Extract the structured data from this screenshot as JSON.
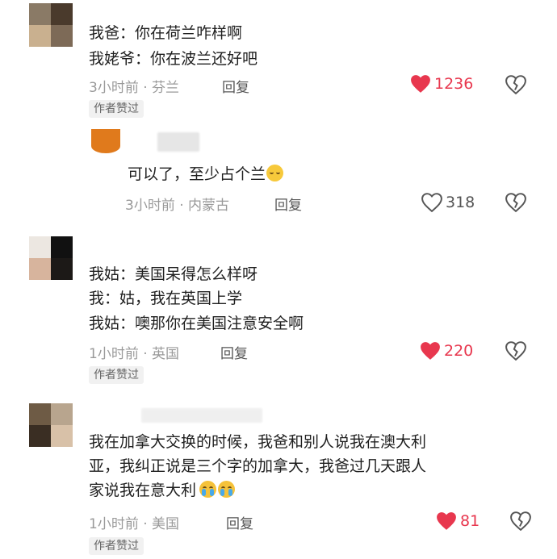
{
  "accent": "#e8374e",
  "comments": [
    {
      "lines": [
        "我爸：你在荷兰咋样啊",
        "我姥爷：你在波兰还好吧"
      ],
      "time_loc": "3小时前 · 芬兰",
      "reply": "回复",
      "likes": "1236",
      "liked": true,
      "badge": "作者赞过"
    },
    {
      "lines": [
        "可以了，至少占个兰"
      ],
      "time_loc": "3小时前 · 内蒙古",
      "reply": "回复",
      "likes": "318",
      "liked": false
    },
    {
      "lines": [
        "我姑：美国呆得怎么样呀",
        "我：姑，我在英国上学",
        "我姑：噢那你在美国注意安全啊"
      ],
      "time_loc": "1小时前 · 英国",
      "reply": "回复",
      "likes": "220",
      "liked": true,
      "badge": "作者赞过"
    },
    {
      "lines": [
        "我在加拿大交换的时候，我爸和别人说我在澳大利",
        "亚，我纠正说是三个字的加拿大，我爸过几天跟人",
        "家说我在意大利"
      ],
      "time_loc": "1小时前 · 美国",
      "reply": "回复",
      "likes": "81",
      "liked": true,
      "badge": "作者赞过"
    }
  ],
  "icons": {
    "like": "heart-icon",
    "dislike": "broken-heart-icon",
    "laugh": "laughing-crying-emoji",
    "cry": "loudly-crying-emoji"
  }
}
